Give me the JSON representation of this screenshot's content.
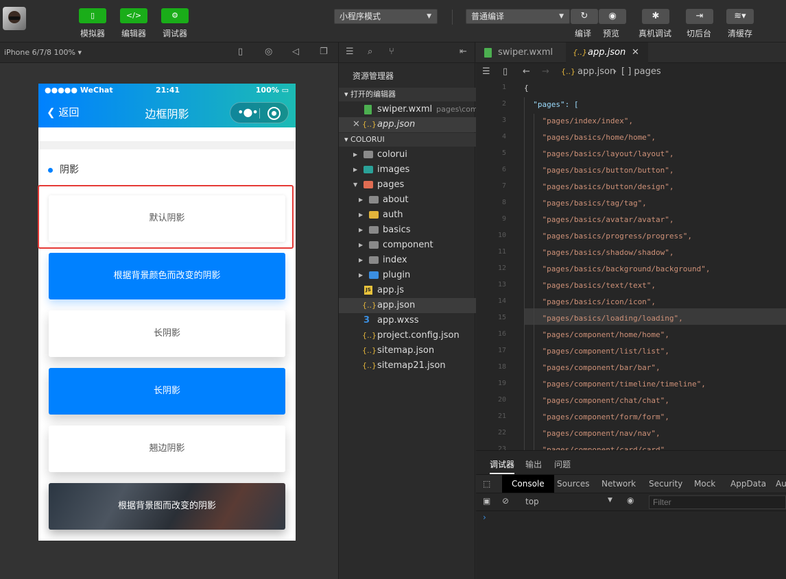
{
  "toolbar": {
    "simulator_label": "模拟器",
    "editor_label": "编辑器",
    "debugger_label": "调试器",
    "mode_select": "小程序模式",
    "compile_select": "普通编译",
    "compile_label": "编译",
    "preview_label": "预览",
    "realdevice_label": "真机调试",
    "background_label": "切后台",
    "clearcache_label": "清缓存",
    "simulator_icon": "</>",
    "editor_icon": "</>",
    "debugger_icon": "⚙"
  },
  "simulator": {
    "device": "iPhone 6/7/8 100%",
    "status": {
      "carrier": "●●●●● WeChat",
      "time": "21:41",
      "battery": "100%"
    },
    "nav": {
      "back": "返回",
      "title": "边框阴影"
    },
    "section": "阴影",
    "cards": [
      {
        "text": "默认阴影",
        "style": "white"
      },
      {
        "text": "根据背景颜色而改变的阴影",
        "style": "blue"
      },
      {
        "text": "长阴影",
        "style": "white"
      },
      {
        "text": "长阴影",
        "style": "blue"
      },
      {
        "text": "翘边阴影",
        "style": "white"
      },
      {
        "text": "根据背景图而改变的阴影",
        "style": "image"
      }
    ]
  },
  "explorer": {
    "title": "资源管理器",
    "open_editors_label": "打开的编辑器",
    "open_editors": [
      {
        "name": "swiper.wxml",
        "path": "pages\\com..."
      },
      {
        "name": "app.json",
        "path": ""
      }
    ],
    "project_label": "COLORUI",
    "tree": [
      {
        "name": "colorui"
      },
      {
        "name": "images"
      },
      {
        "name": "pages"
      },
      {
        "name": "about"
      },
      {
        "name": "auth"
      },
      {
        "name": "basics"
      },
      {
        "name": "component"
      },
      {
        "name": "index"
      },
      {
        "name": "plugin"
      },
      {
        "name": "app.js"
      },
      {
        "name": "app.json"
      },
      {
        "name": "app.wxss"
      },
      {
        "name": "project.config.json"
      },
      {
        "name": "sitemap.json"
      },
      {
        "name": "sitemap21.json"
      }
    ]
  },
  "editor": {
    "tabs": [
      {
        "name": "swiper.wxml"
      },
      {
        "name": "app.json"
      }
    ],
    "breadcrumb": {
      "file": "app.json",
      "node": "[ ] pages"
    },
    "lines": [
      {
        "n": "1",
        "t": "{"
      },
      {
        "n": "2",
        "t": "  \"pages\": ["
      },
      {
        "n": "3",
        "t": "    \"pages/index/index\","
      },
      {
        "n": "4",
        "t": "    \"pages/basics/home/home\","
      },
      {
        "n": "5",
        "t": "    \"pages/basics/layout/layout\","
      },
      {
        "n": "6",
        "t": "    \"pages/basics/button/button\","
      },
      {
        "n": "7",
        "t": "    \"pages/basics/button/design\","
      },
      {
        "n": "8",
        "t": "    \"pages/basics/tag/tag\","
      },
      {
        "n": "9",
        "t": "    \"pages/basics/avatar/avatar\","
      },
      {
        "n": "10",
        "t": "    \"pages/basics/progress/progress\","
      },
      {
        "n": "11",
        "t": "    \"pages/basics/shadow/shadow\","
      },
      {
        "n": "12",
        "t": "    \"pages/basics/background/background\","
      },
      {
        "n": "13",
        "t": "    \"pages/basics/text/text\","
      },
      {
        "n": "14",
        "t": "    \"pages/basics/icon/icon\","
      },
      {
        "n": "15",
        "t": "    \"pages/basics/loading/loading\","
      },
      {
        "n": "16",
        "t": "    \"pages/component/home/home\","
      },
      {
        "n": "17",
        "t": "    \"pages/component/list/list\","
      },
      {
        "n": "18",
        "t": "    \"pages/component/bar/bar\","
      },
      {
        "n": "19",
        "t": "    \"pages/component/timeline/timeline\","
      },
      {
        "n": "20",
        "t": "    \"pages/component/chat/chat\","
      },
      {
        "n": "21",
        "t": "    \"pages/component/form/form\","
      },
      {
        "n": "22",
        "t": "    \"pages/component/nav/nav\","
      },
      {
        "n": "23",
        "t": "    \"pages/component/card/card\","
      }
    ]
  },
  "console": {
    "tabs": [
      "调试器",
      "输出",
      "问题"
    ],
    "devtools": [
      "Console",
      "Sources",
      "Network",
      "Security",
      "Mock",
      "AppData",
      "Au"
    ],
    "context": "top",
    "filter_placeholder": "Filter",
    "prompt": "›"
  }
}
